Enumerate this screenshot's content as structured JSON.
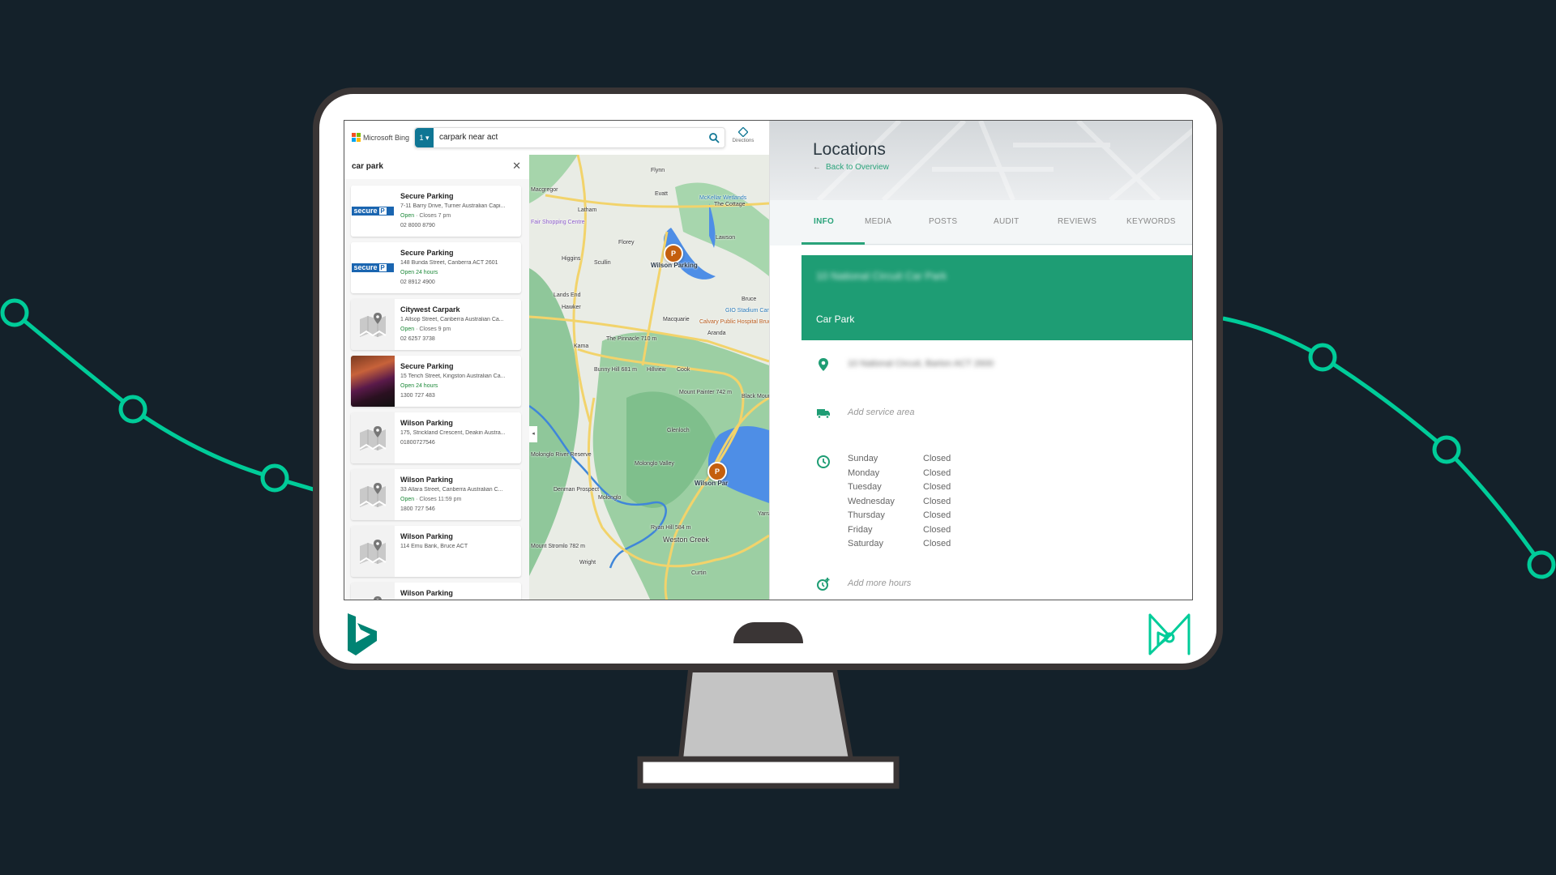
{
  "colors": {
    "background": "#14212a",
    "accent_green": "#00cc99",
    "monitor_border": "#3a3535",
    "brand_green": "#1e9d74",
    "bing_teal": "#0f7694",
    "bing_logo": "#008373"
  },
  "bing": {
    "brand": "Microsoft Bing",
    "search_count": "1",
    "search_query": "carpark near act",
    "directions_label": "Directions",
    "list_query": "car park",
    "results": [
      {
        "name": "Secure Parking",
        "address": "7-11 Barry Drive, Turner Australian Capi...",
        "status_open": "Open",
        "status_rest": " · Closes 7 pm",
        "phone": "02 8000 8790",
        "thumb": "secure-logo"
      },
      {
        "name": "Secure Parking",
        "address": "148 Bunda Street, Canberra ACT 2601",
        "status_open": "Open 24 hours",
        "status_rest": "",
        "phone": "02 8912 4900",
        "thumb": "secure-logo"
      },
      {
        "name": "Citywest Carpark",
        "address": "1 Allsop Street, Canberra Australian Ca...",
        "status_open": "Open",
        "status_rest": " · Closes 9 pm",
        "phone": "02 6257 3738",
        "thumb": "map-placeholder"
      },
      {
        "name": "Secure Parking",
        "address": "15 Tench Street, Kingston Australian Ca...",
        "status_open": "Open 24 hours",
        "status_rest": "",
        "phone": "1300 727 483",
        "thumb": "photo"
      },
      {
        "name": "Wilson Parking",
        "address": "175, Strickland Crescent, Deakin Austra...",
        "status_open": "",
        "status_rest": "",
        "phone": "01800727546",
        "thumb": "map-placeholder"
      },
      {
        "name": "Wilson Parking",
        "address": "33 Allara Street, Canberra Australian C...",
        "status_open": "Open",
        "status_rest": " · Closes 11:59 pm",
        "phone": "1800 727 546",
        "thumb": "map-placeholder"
      },
      {
        "name": "Wilson Parking",
        "address": "114 Emu Bank, Bruce ACT",
        "status_open": "",
        "status_rest": "",
        "phone": "",
        "thumb": "map-placeholder"
      },
      {
        "name": "Wilson Parking",
        "address": "",
        "status_open": "",
        "status_rest": "",
        "phone": "",
        "thumb": "map-placeholder"
      }
    ],
    "map": {
      "labels": [
        "Flynn",
        "Macgregor",
        "Evatt",
        "McKellar Wetlands",
        "The Cottage",
        "Latham",
        "Fair Shopping Centre",
        "Florey",
        "Lawson",
        "Higgins",
        "Scullin",
        "Lands End",
        "Hawker",
        "Bruce",
        "GIO Stadium Canberra",
        "Calvary Public Hospital Bruce",
        "Macquarie",
        "The Pinnacle 710 m",
        "Kama",
        "Aranda",
        "Bunny Hill 681 m",
        "Hillview",
        "Cook",
        "Mount Painter 742 m",
        "Black Mountain Nature Reserve",
        "Glenloch",
        "Molonglo River Reserve",
        "Molonglo Valley",
        "Denman Prospect",
        "Molonglo",
        "Ryan Hill 584 m",
        "Weston Creek",
        "Yarra",
        "Mount Stromlo 782 m",
        "Wright",
        "Curtin"
      ],
      "pins": [
        {
          "label": "Wilson Parking",
          "glyph": "P"
        },
        {
          "label": "Wilson Par",
          "glyph": "P"
        }
      ]
    }
  },
  "locations": {
    "title": "Locations",
    "back_label": "Back to Overview",
    "tabs": [
      "INFO",
      "MEDIA",
      "POSTS",
      "AUDIT",
      "REVIEWS",
      "KEYWORDS"
    ],
    "active_tab": "INFO",
    "business_name_redacted": "10 National Circuit Car Park",
    "category": "Car Park",
    "address_redacted": "10 National Circuit, Barton ACT 2600",
    "service_area_placeholder": "Add service area",
    "hours": [
      {
        "day": "Sunday",
        "value": "Closed"
      },
      {
        "day": "Monday",
        "value": "Closed"
      },
      {
        "day": "Tuesday",
        "value": "Closed"
      },
      {
        "day": "Wednesday",
        "value": "Closed"
      },
      {
        "day": "Thursday",
        "value": "Closed"
      },
      {
        "day": "Friday",
        "value": "Closed"
      },
      {
        "day": "Saturday",
        "value": "Closed"
      }
    ],
    "add_hours_placeholder": "Add more hours"
  }
}
